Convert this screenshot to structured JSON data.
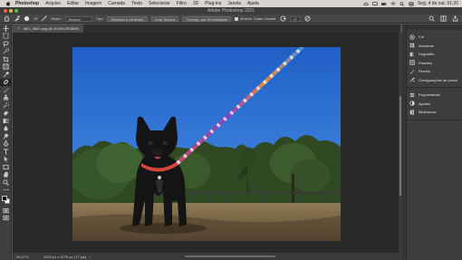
{
  "menubar": {
    "app_name": "Photoshop",
    "menus": [
      "Arquivo",
      "Editar",
      "Imagem",
      "Camada",
      "Texto",
      "Selecionar",
      "Filtro",
      "3D",
      "Plug-ins",
      "Janela",
      "Ajuda"
    ],
    "clock": "Seg. 4 de out.  01:20"
  },
  "window": {
    "title": "Adobe Photoshop 2021"
  },
  "options": {
    "brush_size": "19",
    "mode_label": "Modo:",
    "mode_value": "Normal",
    "type_label": "Tipo:",
    "type_buttons": [
      "Sensível a conteúdo",
      "Criar Textura",
      "Corresp. por Proximidade"
    ],
    "sample_all_layers": "Mostrar Todas Camad.",
    "angle": "0°"
  },
  "document": {
    "tab_title": "IMG_0601.png @ 29,5% (RGB/8*)",
    "zoom": "29,47%",
    "info": "2624 px x 3776 px (72 ppi)"
  },
  "panels": {
    "group1": [
      {
        "label": "Cor",
        "icon": "color-wheel-icon"
      },
      {
        "label": "Amostras",
        "icon": "swatches-grid-icon"
      },
      {
        "label": "Degradês",
        "icon": "gradient-icon"
      },
      {
        "label": "Padrões",
        "icon": "patterns-icon"
      },
      {
        "label": "Pincéis",
        "icon": "brushes-icon"
      },
      {
        "label": "Configurações de pincel",
        "icon": "brush-settings-icon"
      }
    ],
    "group2": [
      {
        "label": "Propriedades",
        "icon": "properties-icon"
      },
      {
        "label": "Ajustes",
        "icon": "adjustments-icon"
      },
      {
        "label": "Bibliotecas",
        "icon": "libraries-icon"
      }
    ]
  },
  "colors": {
    "foreground": "#000000",
    "background": "#ffffff",
    "sky": "#2f6fd2"
  }
}
